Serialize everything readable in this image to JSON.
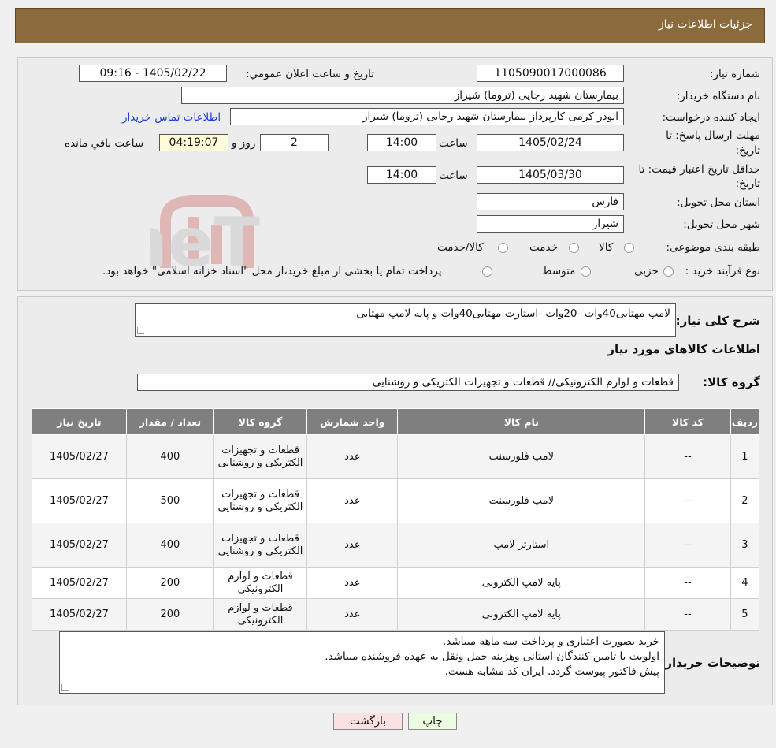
{
  "header": {
    "title": "جزئیات اطلاعات نیاز"
  },
  "form": {
    "need_number_label": "شماره نیاز:",
    "need_number": "1105090017000086",
    "announce_label": "تاریخ و ساعت اعلان عمومي:",
    "announce_value": "1405/02/22 - 09:16",
    "buyer_label": "نام دستگاه خريدار:",
    "buyer_value": "بیمارستان شهید رجایی (تروما) شیراز",
    "creator_label": "ايجاد كننده درخواست:",
    "creator_value": "ابوذر کرمی کارپرداز بیمارستان شهید رجایی (تروما) شیراز",
    "contact_link": "اطلاعات تماس خریدار",
    "deadline_label_1": "مهلت ارسال پاسخ: تا",
    "deadline_label_2": "تاریخ:",
    "deadline_date": "1405/02/24",
    "time_label": "ساعت",
    "deadline_time": "14:00",
    "days_value": "2",
    "days_label": "روز و",
    "remaining_time": "04:19:07",
    "remaining_label": "ساعت باقي مانده",
    "validity_label_1": "حداقل تاریخ اعتبار قیمت: تا",
    "validity_label_2": "تاریخ:",
    "validity_date": "1405/03/30",
    "validity_time": "14:00",
    "province_label": "استان محل تحویل:",
    "province_value": "فارس",
    "city_label": "شهر محل تحویل:",
    "city_value": "شیراز",
    "category_label": "طبقه بندی موضوعی:",
    "category_options": [
      "کالا",
      "خدمت",
      "کالا/خدمت"
    ],
    "process_label": "نوع فرآيند خريد :",
    "process_options": [
      "جزیی",
      "متوسط"
    ],
    "process_note": "پرداخت تمام یا بخشی از مبلغ خرید،از محل \"اسناد خزانه اسلامی\" خواهد بود."
  },
  "description": {
    "label": "شرح کلی نیاز:",
    "value": "لامپ مهتابی40وات -20وات -استارت مهتابی40وات و پایه لامپ مهتابی",
    "goods_info_title": "اطلاعات کالاهای مورد نیاز",
    "group_label": "گروه کالا:",
    "group_value": "قطعات و لوازم الکترونیکی// قطعات و تجهیزات الکتریکی و روشنایی"
  },
  "table": {
    "headers": [
      "ردیف",
      "کد کالا",
      "نام کالا",
      "واحد شمارش",
      "گروه کالا",
      "تعداد / مقدار",
      "تاریخ نیاز"
    ],
    "rows": [
      [
        "1",
        "--",
        "لامپ فلورسنت",
        "عدد",
        "قطعات و تجهیزات الکتریکی و روشنایی",
        "400",
        "1405/02/27"
      ],
      [
        "2",
        "--",
        "لامپ فلورسنت",
        "عدد",
        "قطعات و تجهیزات الکتریکی و روشنایی",
        "500",
        "1405/02/27"
      ],
      [
        "3",
        "--",
        "استارتر لامپ",
        "عدد",
        "قطعات و تجهیزات الکتریکی و روشنایی",
        "400",
        "1405/02/27"
      ],
      [
        "4",
        "--",
        "پایه لامپ الکترونی",
        "عدد",
        "قطعات و لوازم الکترونیکی",
        "200",
        "1405/02/27"
      ],
      [
        "5",
        "--",
        "پایه لامپ الکترونی",
        "عدد",
        "قطعات و لوازم الکترونیکی",
        "200",
        "1405/02/27"
      ]
    ]
  },
  "buyer_notes": {
    "label": "توضیحات خریدار:",
    "lines": [
      "خرید بصورت اعتباری و پرداخت سه ماهه میباشد.",
      "اولویت با تامین کنندگان استانی وهزینه حمل ونقل به عهده فروشنده میباشد.",
      "پیش فاکتور پیوست گردد. ایران کد مشابه هست."
    ]
  },
  "buttons": {
    "print": "چاپ",
    "back": "بازگشت"
  },
  "watermark": {
    "text": "AriaTender.neT"
  }
}
